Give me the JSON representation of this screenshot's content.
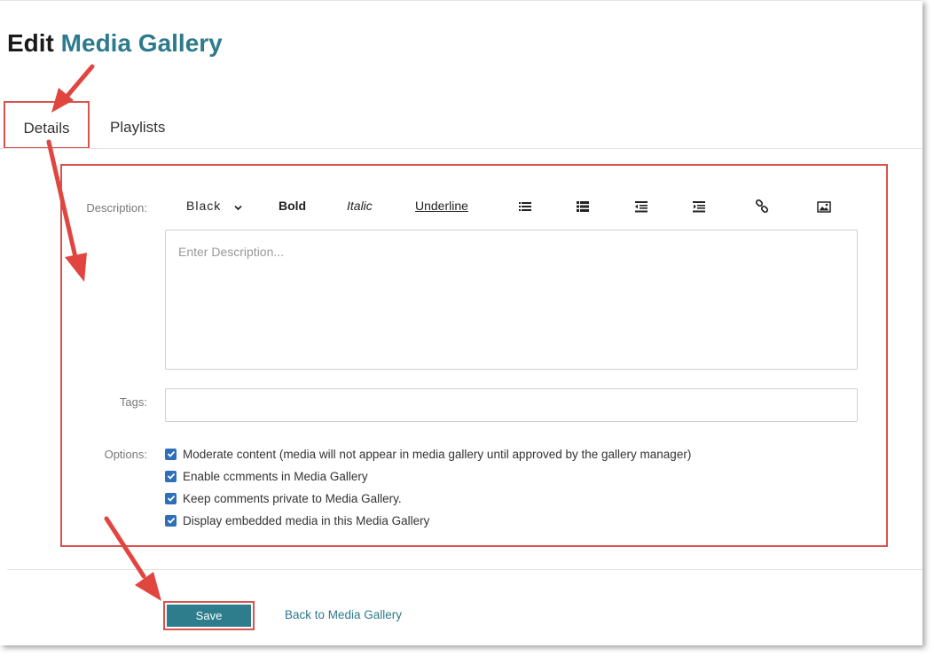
{
  "page": {
    "title_prefix": "Edit",
    "title_accent": "Media Gallery"
  },
  "tabs": [
    {
      "label": "Details",
      "active": true
    },
    {
      "label": "Playlists",
      "active": false
    }
  ],
  "form": {
    "description_label": "Description:",
    "description_placeholder": "Enter Description...",
    "description_value": "",
    "tags_label": "Tags:",
    "tags_value": "",
    "options_label": "Options:"
  },
  "toolbar": {
    "color_select": "Black",
    "bold_label": "Bold",
    "italic_label": "Italic",
    "underline_label": "Underline",
    "icons": [
      "ordered-list-icon",
      "unordered-list-icon",
      "outdent-icon",
      "indent-icon",
      "link-icon",
      "image-icon"
    ]
  },
  "options": [
    {
      "label": "Moderate content (media will not appear in media gallery until approved by the gallery manager)",
      "checked": true
    },
    {
      "label": "Enable ccmments in Media Gallery",
      "checked": true
    },
    {
      "label": "Keep comments private to Media Gallery.",
      "checked": true
    },
    {
      "label": "Display embedded media in this Media Gallery",
      "checked": true
    }
  ],
  "footer": {
    "save_label": "Save",
    "back_link": "Back to Media Gallery"
  },
  "colors": {
    "accent": "#2e7a8c",
    "highlight_red": "#d9534f",
    "checkbox_blue": "#2f6fba"
  }
}
